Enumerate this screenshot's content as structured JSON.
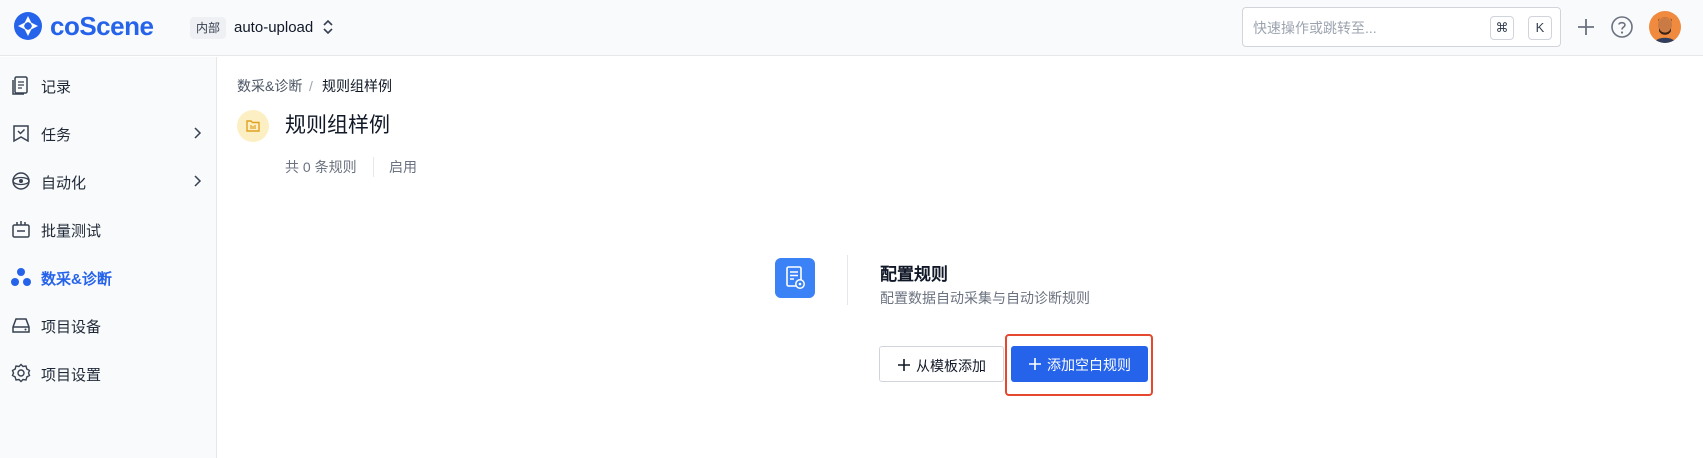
{
  "header": {
    "brand": "coScene",
    "project_badge": "内部",
    "project_name": "auto-upload",
    "search": {
      "placeholder": "快速操作或跳转至...",
      "shortcut_cmd": "⌘",
      "shortcut_key": "K"
    },
    "icons": [
      "plus-icon",
      "help-icon",
      "user-avatar"
    ]
  },
  "sidebar": {
    "items": [
      {
        "label": "记录",
        "icon": "records-icon",
        "has_submenu": false,
        "active": false
      },
      {
        "label": "任务",
        "icon": "tasks-icon",
        "has_submenu": true,
        "active": false
      },
      {
        "label": "自动化",
        "icon": "automation-icon",
        "has_submenu": true,
        "active": false
      },
      {
        "label": "批量测试",
        "icon": "batch-test-icon",
        "has_submenu": false,
        "active": false
      },
      {
        "label": "数采&诊断",
        "icon": "diagnosis-icon",
        "has_submenu": false,
        "active": true
      },
      {
        "label": "项目设备",
        "icon": "devices-icon",
        "has_submenu": false,
        "active": false
      },
      {
        "label": "项目设置",
        "icon": "settings-icon",
        "has_submenu": false,
        "active": false
      }
    ]
  },
  "main": {
    "breadcrumb": {
      "parent": "数采&诊断",
      "separator": "/",
      "current": "规则组样例"
    },
    "title": "规则组样例",
    "meta": {
      "count_text": "共 0 条规则",
      "status": "启用"
    },
    "empty_state": {
      "title": "配置规则",
      "description": "配置数据自动采集与自动诊断规则",
      "template_button": "从模板添加",
      "blank_button": "添加空白规则"
    }
  },
  "colors": {
    "accent": "#2563eb",
    "highlight": "#e5482e",
    "folder_bg": "#fdefc4"
  }
}
